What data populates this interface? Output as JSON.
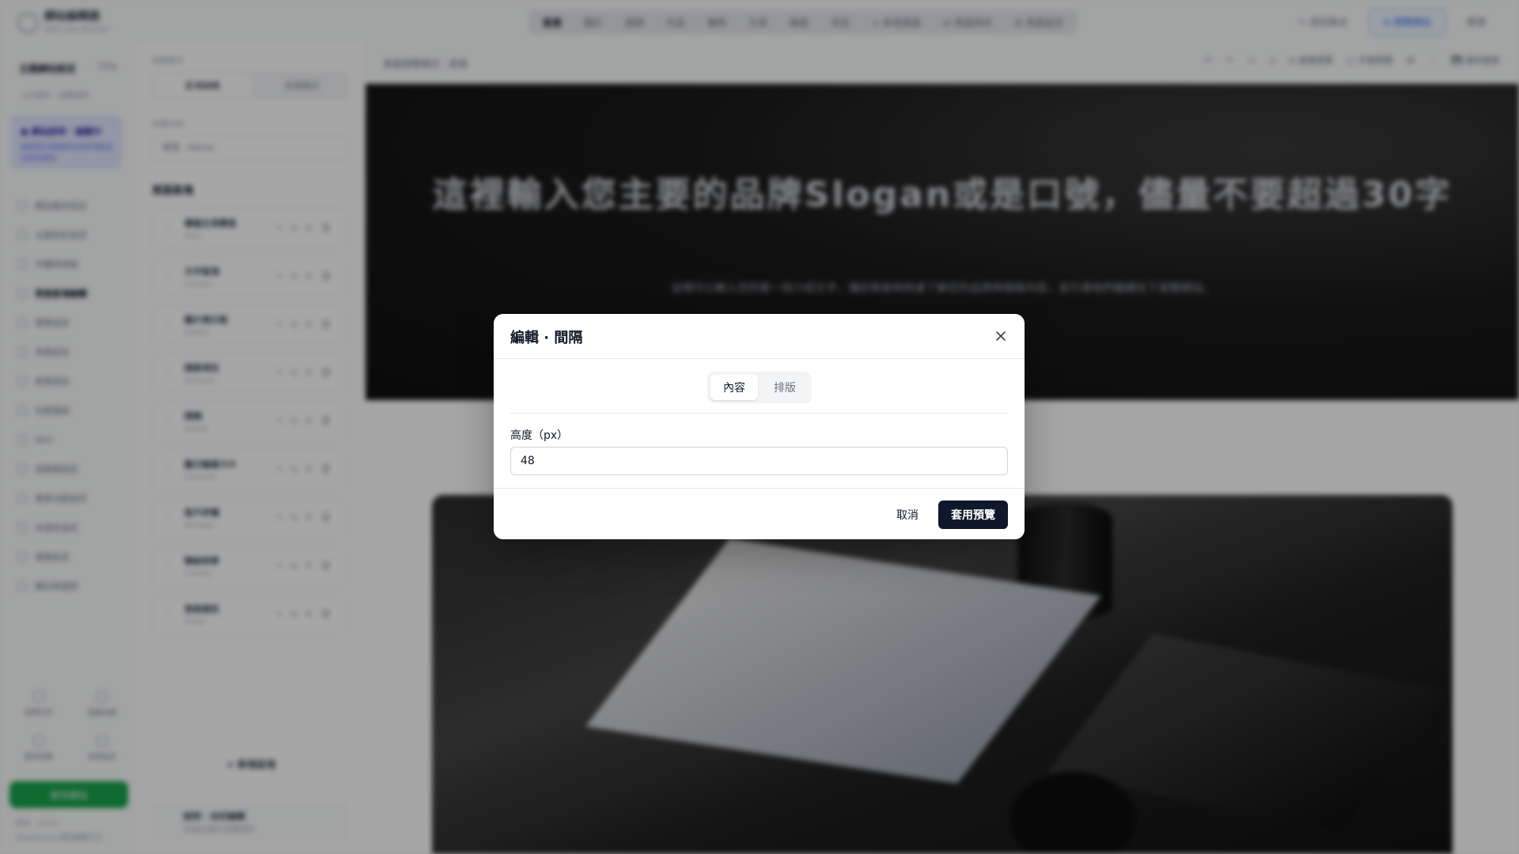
{
  "app": {
    "brand": "網站編輯器",
    "brand_sub": "Web Site Builder",
    "nav_tabs": [
      "首頁",
      "關於",
      "服務",
      "作品",
      "團隊",
      "文章",
      "聯絡",
      "常見",
      "+ 新增頁面",
      "⇄ 頁面排序",
      "⚙ 頁面設定"
    ],
    "top_right": {
      "back": "← 返回後台",
      "preview": "⧉ 預覽網站",
      "account": "帳號"
    },
    "sidebar": {
      "project_title": "主題網站設定",
      "project_pct": "75%",
      "project_sub": "上次儲存：自動儲存",
      "notice_title": "● 網站說明 · 編輯中",
      "notice_text": "請依照左側選單完成各項設定並發布網站",
      "menu": [
        "網站基本設定",
        "主題色彩設定",
        "字體與排版",
        "頁面區塊編輯",
        "選單設定",
        "頁尾設定",
        "表單設定",
        "社群連結",
        "SEO",
        "追蹤碼設定",
        "會員功能設定",
        "多語系設定",
        "進階設定",
        "備份與還原"
      ],
      "active_index": 3,
      "grid": [
        "說明文件",
        "客服支援",
        "版本紀錄",
        "系統設定"
      ],
      "publish": "發布網站",
      "foot1": "版本 · v2.4.1",
      "foot2": "Powered by 網站編輯平台"
    },
    "panel": {
      "label1": "編輯模式",
      "seg": [
        "區塊編輯",
        "全域樣式"
      ],
      "label2": "頁面名稱",
      "input": "首頁 · Home",
      "heading": "頁面區塊",
      "blocks": [
        {
          "title": "橫幅主視覺區",
          "sub": "Hero"
        },
        {
          "title": "文字區塊",
          "sub": "Content"
        },
        {
          "title": "圖片展示區",
          "sub": "Gallery"
        },
        {
          "title": "服務項目",
          "sub": "Services"
        },
        {
          "title": "間隔",
          "sub": "Spacer"
        },
        {
          "title": "圖文輪播卡片",
          "sub": "Carousel"
        },
        {
          "title": "客戶評價",
          "sub": "Reviews"
        },
        {
          "title": "聯絡表單",
          "sub": "Contact"
        },
        {
          "title": "頁尾資訊",
          "sub": "Footer"
        }
      ],
      "add_block": "+ 新增區塊",
      "foot_title": "說明 · 如何編輯",
      "foot_sub": "拖曳區塊即可調整順序"
    },
    "canvas": {
      "crumb": "頁面預覽模式 · 首頁",
      "tools": [
        "↶",
        "↷",
        "▭",
        "▯",
        "⧉ 桌機預覽",
        "▢ 手機預覽",
        "⊞",
        "⋯",
        "💾 儲存變更"
      ],
      "hero_title": "這裡輸入您主要的品牌Slogan或是口號，儘量不要超過30字",
      "hero_sub": "這裡可以輸入您的第一段介紹文字，讓訪客能夠快速了解您的品牌與服務內容，並引導他們繼續往下瀏覽網站。"
    }
  },
  "modal": {
    "title": "編輯 · 間隔",
    "tabs": [
      "內容",
      "排版"
    ],
    "active_tab": 0,
    "field_label": "高度（px）",
    "field_value": "48",
    "cancel": "取消",
    "apply": "套用預覽"
  }
}
